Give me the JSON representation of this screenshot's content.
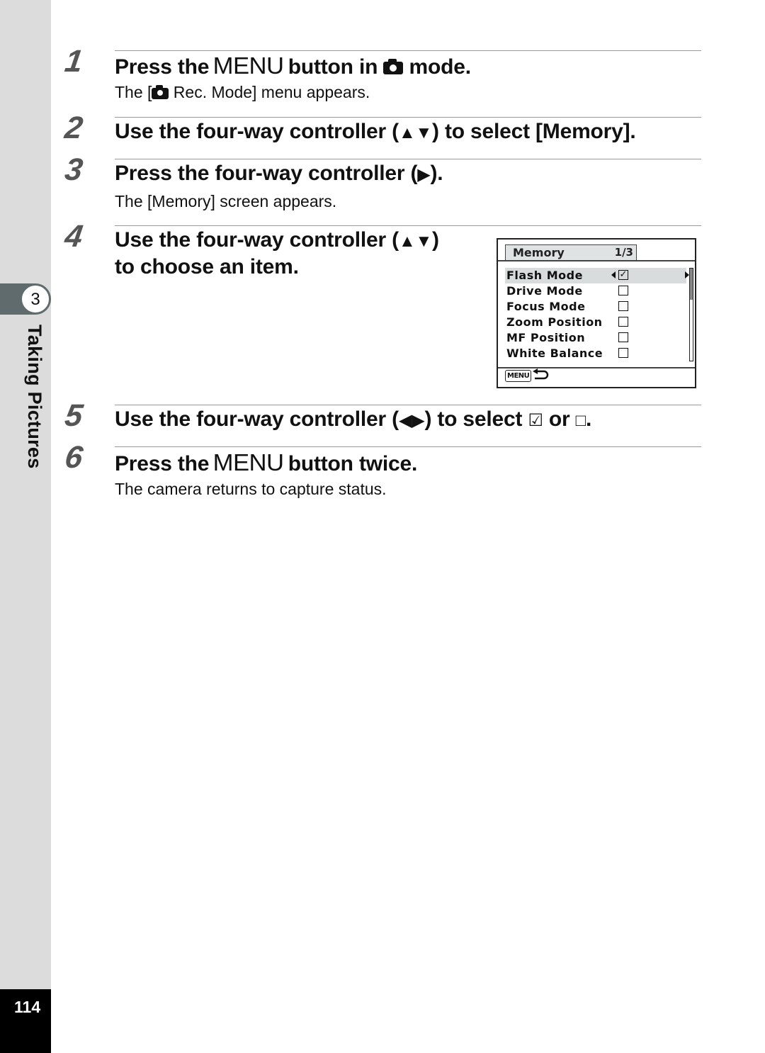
{
  "sidebar": {
    "chapter_number": "3",
    "chapter_title": "Taking Pictures",
    "page_number": "114"
  },
  "steps": [
    {
      "number": "1",
      "title_parts": [
        "Press the ",
        "MENU",
        " button in ",
        "camera-icon",
        " mode."
      ],
      "desc_parts": [
        "The [",
        "camera-icon",
        " Rec. Mode] menu appears."
      ]
    },
    {
      "number": "2",
      "title_parts": [
        "Use the four-way controller (",
        "▲▼",
        ") to select [Memory]."
      ]
    },
    {
      "number": "3",
      "title_parts": [
        "Press the four-way controller (",
        "▶",
        ")."
      ],
      "desc": "The [Memory] screen appears."
    },
    {
      "number": "4",
      "title_line1_parts": [
        "Use the four-way controller (",
        "▲▼",
        ")"
      ],
      "title_line2": "to choose an item."
    },
    {
      "number": "5",
      "title_parts": [
        "Use the four-way controller (",
        "◀▶",
        ") to select ",
        "☑",
        " or ",
        "□",
        "."
      ]
    },
    {
      "number": "6",
      "title_parts": [
        "Press the ",
        "MENU",
        " button twice."
      ],
      "desc": "The camera returns to capture status."
    }
  ],
  "screen": {
    "title": "Memory",
    "page": "1/3",
    "items": [
      {
        "label": "Flash Mode",
        "checked": true,
        "selected": true,
        "check_glyph": "✓"
      },
      {
        "label": "Drive Mode",
        "checked": false,
        "selected": false,
        "check_glyph": ""
      },
      {
        "label": "Focus Mode",
        "checked": false,
        "selected": false,
        "check_glyph": ""
      },
      {
        "label": "Zoom Position",
        "checked": false,
        "selected": false,
        "check_glyph": ""
      },
      {
        "label": "MF Position",
        "checked": false,
        "selected": false,
        "check_glyph": ""
      },
      {
        "label": "White Balance",
        "checked": false,
        "selected": false,
        "check_glyph": ""
      }
    ],
    "scroll_position": 0.0,
    "footer_button": "MENU",
    "footer_icon": "back-arrow-icon"
  },
  "colors": {
    "sidebar_bg": "#dcdcdc",
    "chapter_tab": "#5f6b6d",
    "page_number_bg": "#000000",
    "step_number": "#555555",
    "rule": "#999999",
    "screen_highlight": "#d8dcdc"
  }
}
